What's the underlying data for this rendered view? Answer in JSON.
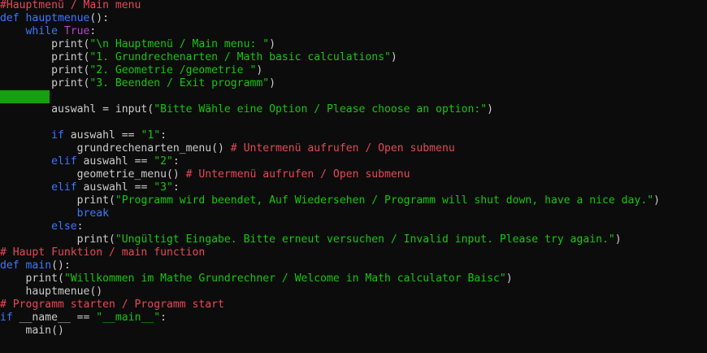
{
  "editor": {
    "cursor_line_index": 7,
    "colors": {
      "background": "#0c0c0c",
      "default_text": "#cccccc",
      "keyword": "#3b78ff",
      "boolean_keyword": "#b148c6",
      "string": "#16c60c",
      "comment": "#e74856",
      "cursor_highlight": "#13a10e"
    },
    "lines": [
      [
        {
          "t": "#Hauptmenü / Main menu",
          "c": "comment"
        }
      ],
      [
        {
          "t": "def ",
          "c": "kw"
        },
        {
          "t": "hauptmenue",
          "c": "def"
        },
        {
          "t": "():",
          "c": "text"
        }
      ],
      [
        {
          "t": "    while ",
          "c": "kw"
        },
        {
          "t": "True",
          "c": "purple"
        },
        {
          "t": ":",
          "c": "text"
        }
      ],
      [
        {
          "t": "        print(",
          "c": "text"
        },
        {
          "t": "\"\\n Hauptmenü / Main menu: \"",
          "c": "str"
        },
        {
          "t": ")",
          "c": "text"
        }
      ],
      [
        {
          "t": "        print(",
          "c": "text"
        },
        {
          "t": "\"1. Grundrechenarten / Math basic calculations\"",
          "c": "str"
        },
        {
          "t": ")",
          "c": "text"
        }
      ],
      [
        {
          "t": "        print(",
          "c": "text"
        },
        {
          "t": "\"2. Geometrie /geometrie \"",
          "c": "str"
        },
        {
          "t": ")",
          "c": "text"
        }
      ],
      [
        {
          "t": "        print(",
          "c": "text"
        },
        {
          "t": "\"3. Beenden / Exit programm\"",
          "c": "str"
        },
        {
          "t": ")",
          "c": "text"
        }
      ],
      [],
      [
        {
          "t": "        auswahl = input(",
          "c": "text"
        },
        {
          "t": "\"Bitte Wähle eine Option / Please choose an option:\"",
          "c": "str"
        },
        {
          "t": ")",
          "c": "text"
        }
      ],
      [],
      [
        {
          "t": "        ",
          "c": "text"
        },
        {
          "t": "if ",
          "c": "kw"
        },
        {
          "t": "auswahl == ",
          "c": "text"
        },
        {
          "t": "\"1\"",
          "c": "str"
        },
        {
          "t": ":",
          "c": "text"
        }
      ],
      [
        {
          "t": "            grundrechenarten_menu() ",
          "c": "text"
        },
        {
          "t": "# Untermenü aufrufen / Open submenu",
          "c": "comment"
        }
      ],
      [
        {
          "t": "        ",
          "c": "text"
        },
        {
          "t": "elif ",
          "c": "kw"
        },
        {
          "t": "auswahl == ",
          "c": "text"
        },
        {
          "t": "\"2\"",
          "c": "str"
        },
        {
          "t": ":",
          "c": "text"
        }
      ],
      [
        {
          "t": "            geometrie_menu() ",
          "c": "text"
        },
        {
          "t": "# Untermenü aufrufen / Open submenu",
          "c": "comment"
        }
      ],
      [
        {
          "t": "        ",
          "c": "text"
        },
        {
          "t": "elif ",
          "c": "kw"
        },
        {
          "t": "auswahl == ",
          "c": "text"
        },
        {
          "t": "\"3\"",
          "c": "str"
        },
        {
          "t": ":",
          "c": "text"
        }
      ],
      [
        {
          "t": "            print(",
          "c": "text"
        },
        {
          "t": "\"Programm wird beendet, Auf Wiedersehen / Programm will shut down, have a nice day.\"",
          "c": "str"
        },
        {
          "t": ")",
          "c": "text"
        }
      ],
      [
        {
          "t": "            ",
          "c": "text"
        },
        {
          "t": "break",
          "c": "kw"
        }
      ],
      [
        {
          "t": "        ",
          "c": "text"
        },
        {
          "t": "else",
          "c": "kw"
        },
        {
          "t": ":",
          "c": "text"
        }
      ],
      [
        {
          "t": "            print(",
          "c": "text"
        },
        {
          "t": "\"Ungültigt Eingabe. Bitte erneut versuchen / Invalid input. Please try again.\"",
          "c": "str"
        },
        {
          "t": ")",
          "c": "text"
        }
      ],
      [
        {
          "t": "# Haupt Funktion / main function",
          "c": "comment"
        }
      ],
      [
        {
          "t": "def ",
          "c": "kw"
        },
        {
          "t": "main",
          "c": "def"
        },
        {
          "t": "():",
          "c": "text"
        }
      ],
      [
        {
          "t": "    print(",
          "c": "text"
        },
        {
          "t": "\"Willkommen im Mathe Grundrechner / Welcome in Math calculator Baisc\"",
          "c": "str"
        },
        {
          "t": ")",
          "c": "text"
        }
      ],
      [
        {
          "t": "    hauptmenue()",
          "c": "text"
        }
      ],
      [
        {
          "t": "# Programm starten / Programm start",
          "c": "comment"
        }
      ],
      [
        {
          "t": "if ",
          "c": "kw"
        },
        {
          "t": "__name__ == ",
          "c": "text"
        },
        {
          "t": "\"__main__\"",
          "c": "str"
        },
        {
          "t": ":",
          "c": "text"
        }
      ],
      [
        {
          "t": "    main()",
          "c": "text"
        }
      ]
    ]
  }
}
